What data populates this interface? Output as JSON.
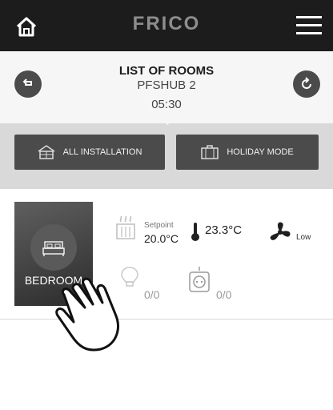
{
  "app": {
    "logo": "FRICO"
  },
  "header": {
    "title": "LIST OF ROOMS",
    "hub": "PFSHUB 2",
    "time": "05:30"
  },
  "buttons": {
    "all_installation": "ALL INSTALLATION",
    "holiday_mode": "HOLIDAY MODE"
  },
  "room": {
    "name": "BEDROOM",
    "setpoint_label": "Setpoint",
    "setpoint_value": "20.0°C",
    "temperature": "23.3°C",
    "fan_level": "Low",
    "light_status": "0/0",
    "socket_status": "0/0"
  },
  "icons": {
    "home": "home-icon",
    "menu": "hamburger-menu-icon",
    "back": "back-arrow-icon",
    "refresh": "refresh-icon",
    "building": "building-icon",
    "suitcase": "suitcase-icon",
    "bed": "bed-icon",
    "heater": "heater-icon",
    "thermometer": "thermometer-icon",
    "fan": "fan-icon",
    "bulb": "light-bulb-icon",
    "socket": "socket-icon",
    "hand": "tap-hand-icon"
  }
}
